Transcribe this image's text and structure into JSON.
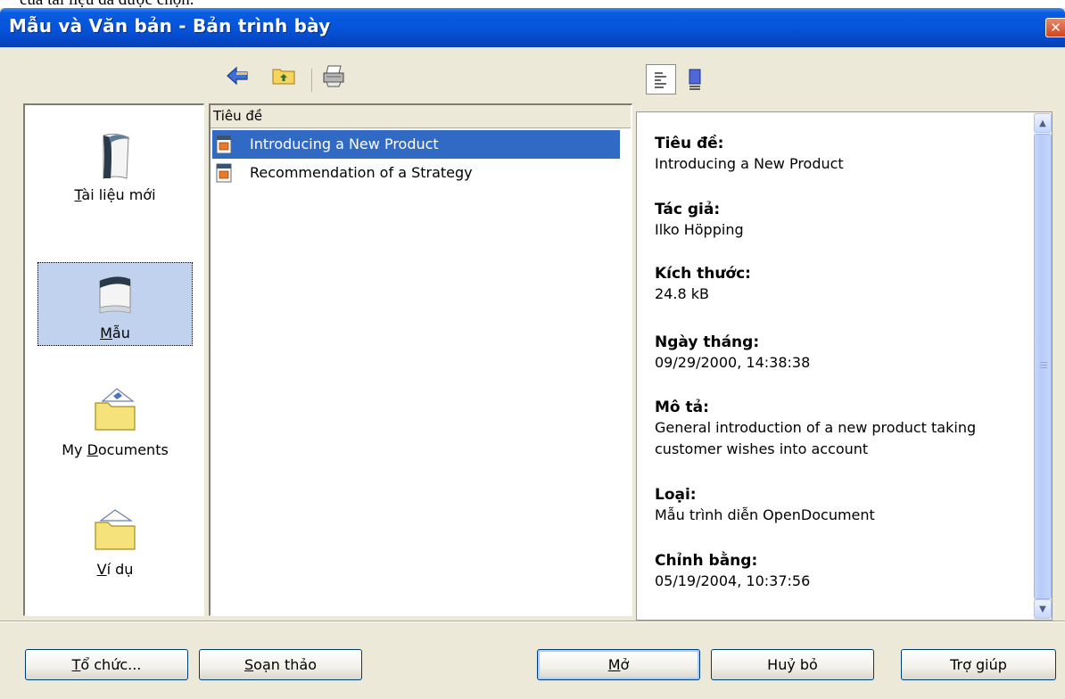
{
  "cutoff_text": "của tài liệu đã được chọn.",
  "window": {
    "title": "Mẫu và Văn bản - Bản trình bày",
    "close_glyph": "✕"
  },
  "toolbar": {
    "icons": [
      "back-arrow-icon",
      "up-folder-icon",
      "print-icon"
    ],
    "view_toggles": [
      "document-properties-icon",
      "preview-icon"
    ]
  },
  "sidebar": {
    "items": [
      {
        "pre": "",
        "mnemonic": "T",
        "post": "ài liệu mới"
      },
      {
        "pre": "",
        "mnemonic": "M",
        "post": "ẫu"
      },
      {
        "pre": "My ",
        "mnemonic": "D",
        "post": "ocuments"
      },
      {
        "pre": "",
        "mnemonic": "V",
        "post": "í dụ"
      }
    ]
  },
  "file_list": {
    "column_header": "Tiêu đề",
    "rows": [
      {
        "name": "Introducing a New Product"
      },
      {
        "name": "Recommendation of a Strategy"
      }
    ]
  },
  "details": {
    "properties": [
      {
        "key": "Tiêu đề:",
        "value": "Introducing a New Product"
      },
      {
        "key": "Tác giả:",
        "value": "Ilko Höpping"
      },
      {
        "key": "Kích thước:",
        "value": "24.8 kB"
      },
      {
        "key": "Ngày tháng:",
        "value": "09/29/2000, 14:38:38"
      },
      {
        "key": "Mô tả:",
        "value": "General introduction of a new product taking customer wishes into account"
      },
      {
        "key": "Loại:",
        "value": "Mẫu trình diễn OpenDocument"
      },
      {
        "key": "Chỉnh bằng:",
        "value": "05/19/2004, 10:37:56"
      }
    ]
  },
  "buttons": {
    "organize": {
      "mnemonic": "T",
      "post": "ổ chức..."
    },
    "edit": {
      "mnemonic": "S",
      "post": "oạn thảo"
    },
    "open": {
      "mnemonic": "M",
      "post": "ở"
    },
    "cancel": "Huỷ bỏ",
    "help": "Trợ giúp"
  },
  "colors": {
    "titlebar": "#0553d8",
    "selection": "#316ac5",
    "dialog_bg": "#ece9d8"
  }
}
